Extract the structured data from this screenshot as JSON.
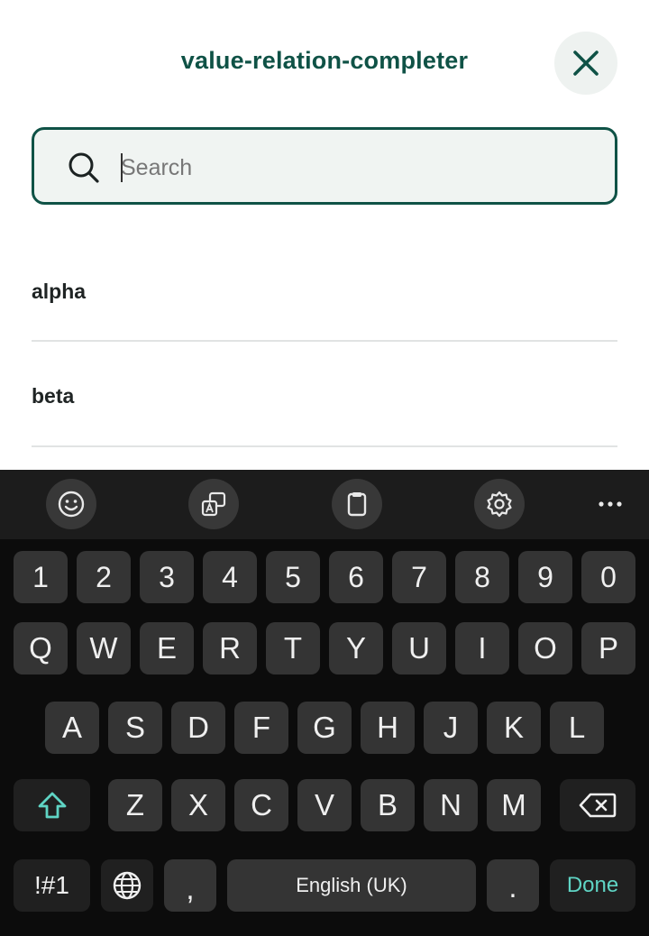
{
  "sheet": {
    "title": "value-relation-completer",
    "close_icon": "close-icon"
  },
  "search": {
    "placeholder": "Search",
    "value": "",
    "icon": "search-icon"
  },
  "list": {
    "items": [
      {
        "label": "alpha"
      },
      {
        "label": "beta"
      }
    ]
  },
  "keyboard": {
    "toolbar": {
      "icons": [
        "emoji-icon",
        "translate-icon",
        "clipboard-icon",
        "settings-icon",
        "more-icon"
      ]
    },
    "rows": {
      "numbers": [
        "1",
        "2",
        "3",
        "4",
        "5",
        "6",
        "7",
        "8",
        "9",
        "0"
      ],
      "row1": [
        "Q",
        "W",
        "E",
        "R",
        "T",
        "Y",
        "U",
        "I",
        "O",
        "P"
      ],
      "row2": [
        "A",
        "S",
        "D",
        "F",
        "G",
        "H",
        "J",
        "K",
        "L"
      ],
      "row3": [
        "Z",
        "X",
        "C",
        "V",
        "B",
        "N",
        "M"
      ]
    },
    "bottom": {
      "symbols": "!#1",
      "comma": ",",
      "space": "English (UK)",
      "period": ".",
      "done": "Done"
    },
    "colors": {
      "accent": "#5fd4c4",
      "key": "#343434",
      "background": "#0c0c0c"
    }
  },
  "colors": {
    "brand": "#0f5246"
  }
}
